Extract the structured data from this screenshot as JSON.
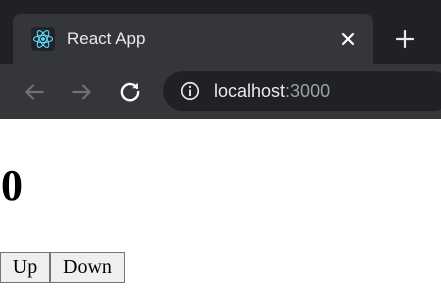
{
  "browser": {
    "tab": {
      "title": "React App",
      "favicon": "react-logo-icon",
      "close_icon": "close-icon"
    },
    "new_tab_icon": "plus-icon",
    "toolbar": {
      "back_icon": "back-arrow-icon",
      "forward_icon": "forward-arrow-icon",
      "reload_icon": "reload-icon",
      "info_icon": "info-icon",
      "url_host": "localhost",
      "url_port": ":3000"
    },
    "colors": {
      "tabstrip": "#202124",
      "active_tab": "#35363a",
      "omnibox": "#202124",
      "react_accent": "#61dafb"
    }
  },
  "page": {
    "counter_value": "0",
    "buttons": {
      "up": "Up",
      "down": "Down"
    }
  }
}
